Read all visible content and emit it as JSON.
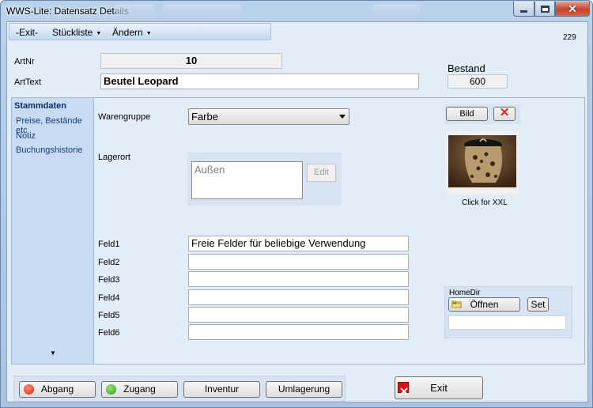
{
  "window": {
    "title": "WWS-Lite: Datensatz Details",
    "record_no": "229"
  },
  "menu": {
    "exit": "-Exit-",
    "stueckliste": "Stückliste",
    "aendern": "Ändern"
  },
  "header": {
    "artnr_label": "ArtNr",
    "artnr_value": "10",
    "arttext_label": "ArtText",
    "arttext_value": "Beutel Leopard",
    "bestand_label": "Bestand",
    "bestand_value": "600"
  },
  "tabs": [
    {
      "label": "Stammdaten"
    },
    {
      "label": "Preise, Bestände etc"
    },
    {
      "label": "Notiz"
    },
    {
      "label": "Buchungshistorie"
    }
  ],
  "form": {
    "warengruppe_label": "Warengruppe",
    "warengruppe_value": "Farbe",
    "lagerort_label": "Lagerort",
    "lagerort_value": "Außen",
    "edit_button": "Edit",
    "felder": [
      {
        "label": "Feld1",
        "value": "Freie Felder für beliebige Verwendung"
      },
      {
        "label": "Feld2",
        "value": ""
      },
      {
        "label": "Feld3",
        "value": ""
      },
      {
        "label": "Feld4",
        "value": ""
      },
      {
        "label": "Feld5",
        "value": ""
      },
      {
        "label": "Feld6",
        "value": ""
      }
    ]
  },
  "image_panel": {
    "bild_button": "Bild",
    "delete_glyph": "✕",
    "caption": "Click for XXL"
  },
  "homedir": {
    "label": "HomeDir",
    "open_button": "Öffnen",
    "set_button": "Set",
    "value": ""
  },
  "buttons": {
    "abgang": "Abgang",
    "zugang": "Zugang",
    "inventur": "Inventur",
    "umlagerung": "Umlagerung",
    "exit": "Exit"
  },
  "colors": {
    "window_frame": "#b9d1ea",
    "client_bg": "#e3edf8",
    "tab_bg": "#c7dcf2",
    "abgang_icon": "#e03a2a",
    "zugang_icon": "#3fae2a"
  }
}
